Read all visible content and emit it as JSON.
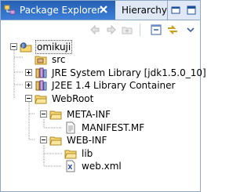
{
  "view": {
    "active_tab": "Package Explorer",
    "inactive_tab": "Hierarchy"
  },
  "tree": {
    "root": "omikuji",
    "src": "src",
    "jre": "JRE System Library [jdk1.5.0_10]",
    "j2ee": "J2EE 1.4 Library Container",
    "webroot": "WebRoot",
    "metainf": "META-INF",
    "manifest": "MANIFEST.MF",
    "webinf": "WEB-INF",
    "lib": "lib",
    "webxml": "web.xml"
  },
  "icons": {
    "view": "package-explorer-icon",
    "project": "java-project-icon",
    "source_folder": "source-folder-icon",
    "library": "library-icon",
    "folder": "folder-icon",
    "file": "file-icon",
    "xml": "xml-file-icon"
  },
  "colors": {
    "tab_active_bg": "#3d7fd8",
    "folder": "#f7d674",
    "border": "#8fa8c8"
  }
}
